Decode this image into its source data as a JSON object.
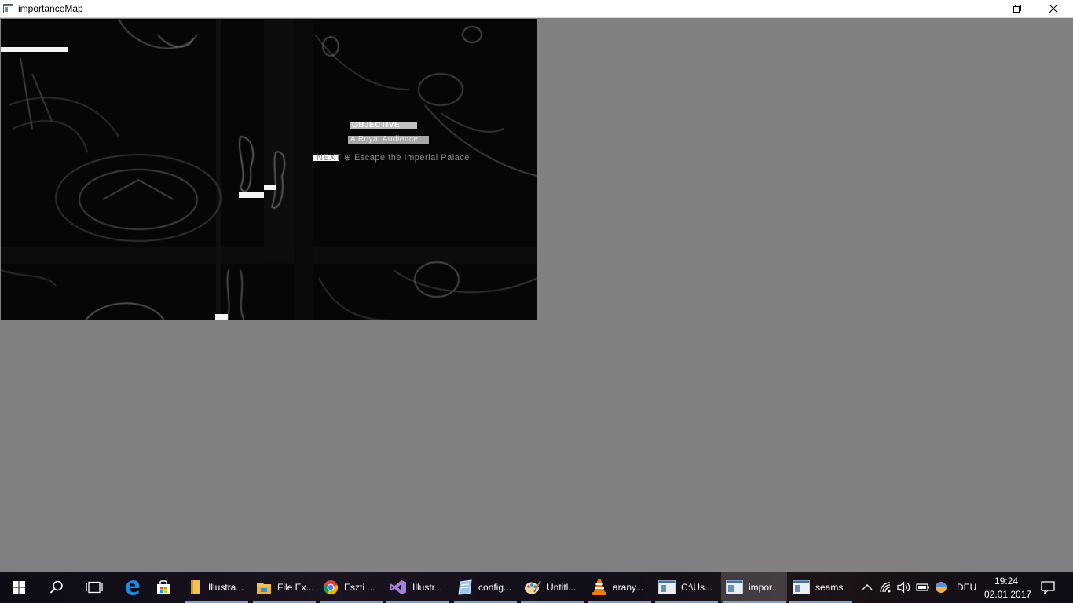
{
  "window": {
    "title": "importanceMap"
  },
  "importance_map": {
    "text_objective": "OBJECTIVE",
    "text_audience": "A Royal Audience",
    "text_escape": "NEXT  ⊕ Escape the Imperial Palace"
  },
  "taskbar": {
    "start_label": "Start",
    "apps": [
      {
        "label": "Illustra...",
        "icon": "folder-icon"
      },
      {
        "label": "File Ex...",
        "icon": "file-explorer-icon"
      },
      {
        "label": "Eszti ...",
        "icon": "chrome-icon"
      },
      {
        "label": "Illustr...",
        "icon": "visual-studio-icon"
      },
      {
        "label": "config...",
        "icon": "notepad-icon"
      },
      {
        "label": "Untitl...",
        "icon": "paint-icon"
      },
      {
        "label": "arany...",
        "icon": "vlc-icon"
      },
      {
        "label": "C:\\Us...",
        "icon": "console-window-icon"
      },
      {
        "label": "impor...",
        "icon": "app-window-icon"
      },
      {
        "label": "seams",
        "icon": "app-window-icon"
      }
    ],
    "tray": {
      "language": "DEU",
      "time": "19:24",
      "date": "02.01.2017"
    }
  }
}
